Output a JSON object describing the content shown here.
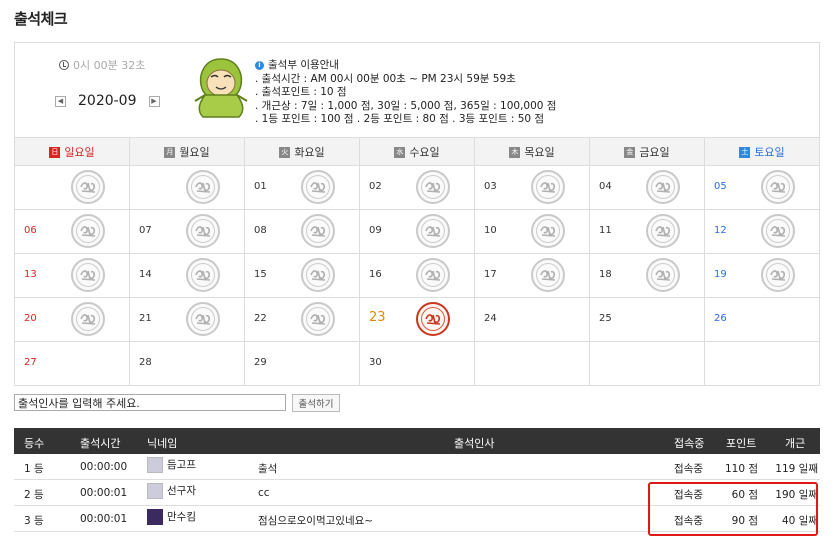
{
  "page_title": "출석체크",
  "clock": "0시 00분 32초",
  "month": "2020-09",
  "prev_label": "◀",
  "next_label": "▶",
  "guide": {
    "title": "출석부 이용안내",
    "lines": [
      ". 출석시간 : AM 00시 00분 00초 ~ PM 23시 59분 59초",
      ". 출석포인트 : 10 점",
      ". 개근상 : 7일 : 1,000 점,   30일 : 5,000 점,   365일 : 100,000 점",
      ". 1등 포인트 : 100 점   . 2등 포인트 : 80 점   . 3등 포인트 : 50 점"
    ]
  },
  "weekdays": [
    {
      "label": "일요일",
      "abbr": "日",
      "kind": "sun"
    },
    {
      "label": "월요일",
      "abbr": "月",
      "kind": ""
    },
    {
      "label": "화요일",
      "abbr": "火",
      "kind": ""
    },
    {
      "label": "수요일",
      "abbr": "水",
      "kind": ""
    },
    {
      "label": "목요일",
      "abbr": "木",
      "kind": ""
    },
    {
      "label": "금요일",
      "abbr": "金",
      "kind": ""
    },
    {
      "label": "토요일",
      "abbr": "土",
      "kind": "sat"
    }
  ],
  "weeks": [
    [
      {
        "d": "",
        "stamp": "gray"
      },
      {
        "d": "",
        "stamp": "gray"
      },
      {
        "d": "01",
        "stamp": "gray"
      },
      {
        "d": "02",
        "stamp": "gray"
      },
      {
        "d": "03",
        "stamp": "gray"
      },
      {
        "d": "04",
        "stamp": "gray"
      },
      {
        "d": "05",
        "stamp": "gray"
      }
    ],
    [
      {
        "d": "06",
        "stamp": "gray"
      },
      {
        "d": "07",
        "stamp": "gray"
      },
      {
        "d": "08",
        "stamp": "gray"
      },
      {
        "d": "09",
        "stamp": "gray"
      },
      {
        "d": "10",
        "stamp": "gray"
      },
      {
        "d": "11",
        "stamp": "gray"
      },
      {
        "d": "12",
        "stamp": "gray"
      }
    ],
    [
      {
        "d": "13",
        "stamp": "gray"
      },
      {
        "d": "14",
        "stamp": "gray"
      },
      {
        "d": "15",
        "stamp": "gray"
      },
      {
        "d": "16",
        "stamp": "gray"
      },
      {
        "d": "17",
        "stamp": "gray"
      },
      {
        "d": "18",
        "stamp": "gray"
      },
      {
        "d": "19",
        "stamp": "gray"
      }
    ],
    [
      {
        "d": "20",
        "stamp": "gray"
      },
      {
        "d": "21",
        "stamp": "gray"
      },
      {
        "d": "22",
        "stamp": "gray"
      },
      {
        "d": "23",
        "stamp": "red",
        "today": true
      },
      {
        "d": "24",
        "stamp": ""
      },
      {
        "d": "25",
        "stamp": ""
      },
      {
        "d": "26",
        "stamp": ""
      }
    ],
    [
      {
        "d": "27",
        "stamp": ""
      },
      {
        "d": "28",
        "stamp": ""
      },
      {
        "d": "29",
        "stamp": ""
      },
      {
        "d": "30",
        "stamp": ""
      },
      {
        "d": "",
        "stamp": ""
      },
      {
        "d": "",
        "stamp": ""
      },
      {
        "d": "",
        "stamp": ""
      }
    ]
  ],
  "greeting": {
    "value": "출석인사를 입력해 주세요.",
    "button": "출석하기"
  },
  "ranking": {
    "headers": {
      "rank": "등수",
      "time": "출석시간",
      "nick": "닉네임",
      "msg": "출석인사",
      "conn": "접속중",
      "point": "포인트",
      "streak": "개근"
    },
    "rows": [
      {
        "rank": "1 등",
        "time": "00:00:00",
        "nick": "듬고프",
        "msg": "출석",
        "conn": "접속중",
        "point": "110 점",
        "streak": "119 일째",
        "avatar": "gray"
      },
      {
        "rank": "2 등",
        "time": "00:00:01",
        "nick": "선구자",
        "msg": "cc",
        "conn": "접속중",
        "point": "60 점",
        "streak": "190 일째",
        "avatar": "gray"
      },
      {
        "rank": "3 등",
        "time": "00:00:01",
        "nick": "만수킴",
        "msg": "점심으로오이먹고있네요~",
        "conn": "접속중",
        "point": "90 점",
        "streak": "40 일째",
        "avatar": "mx"
      }
    ]
  }
}
